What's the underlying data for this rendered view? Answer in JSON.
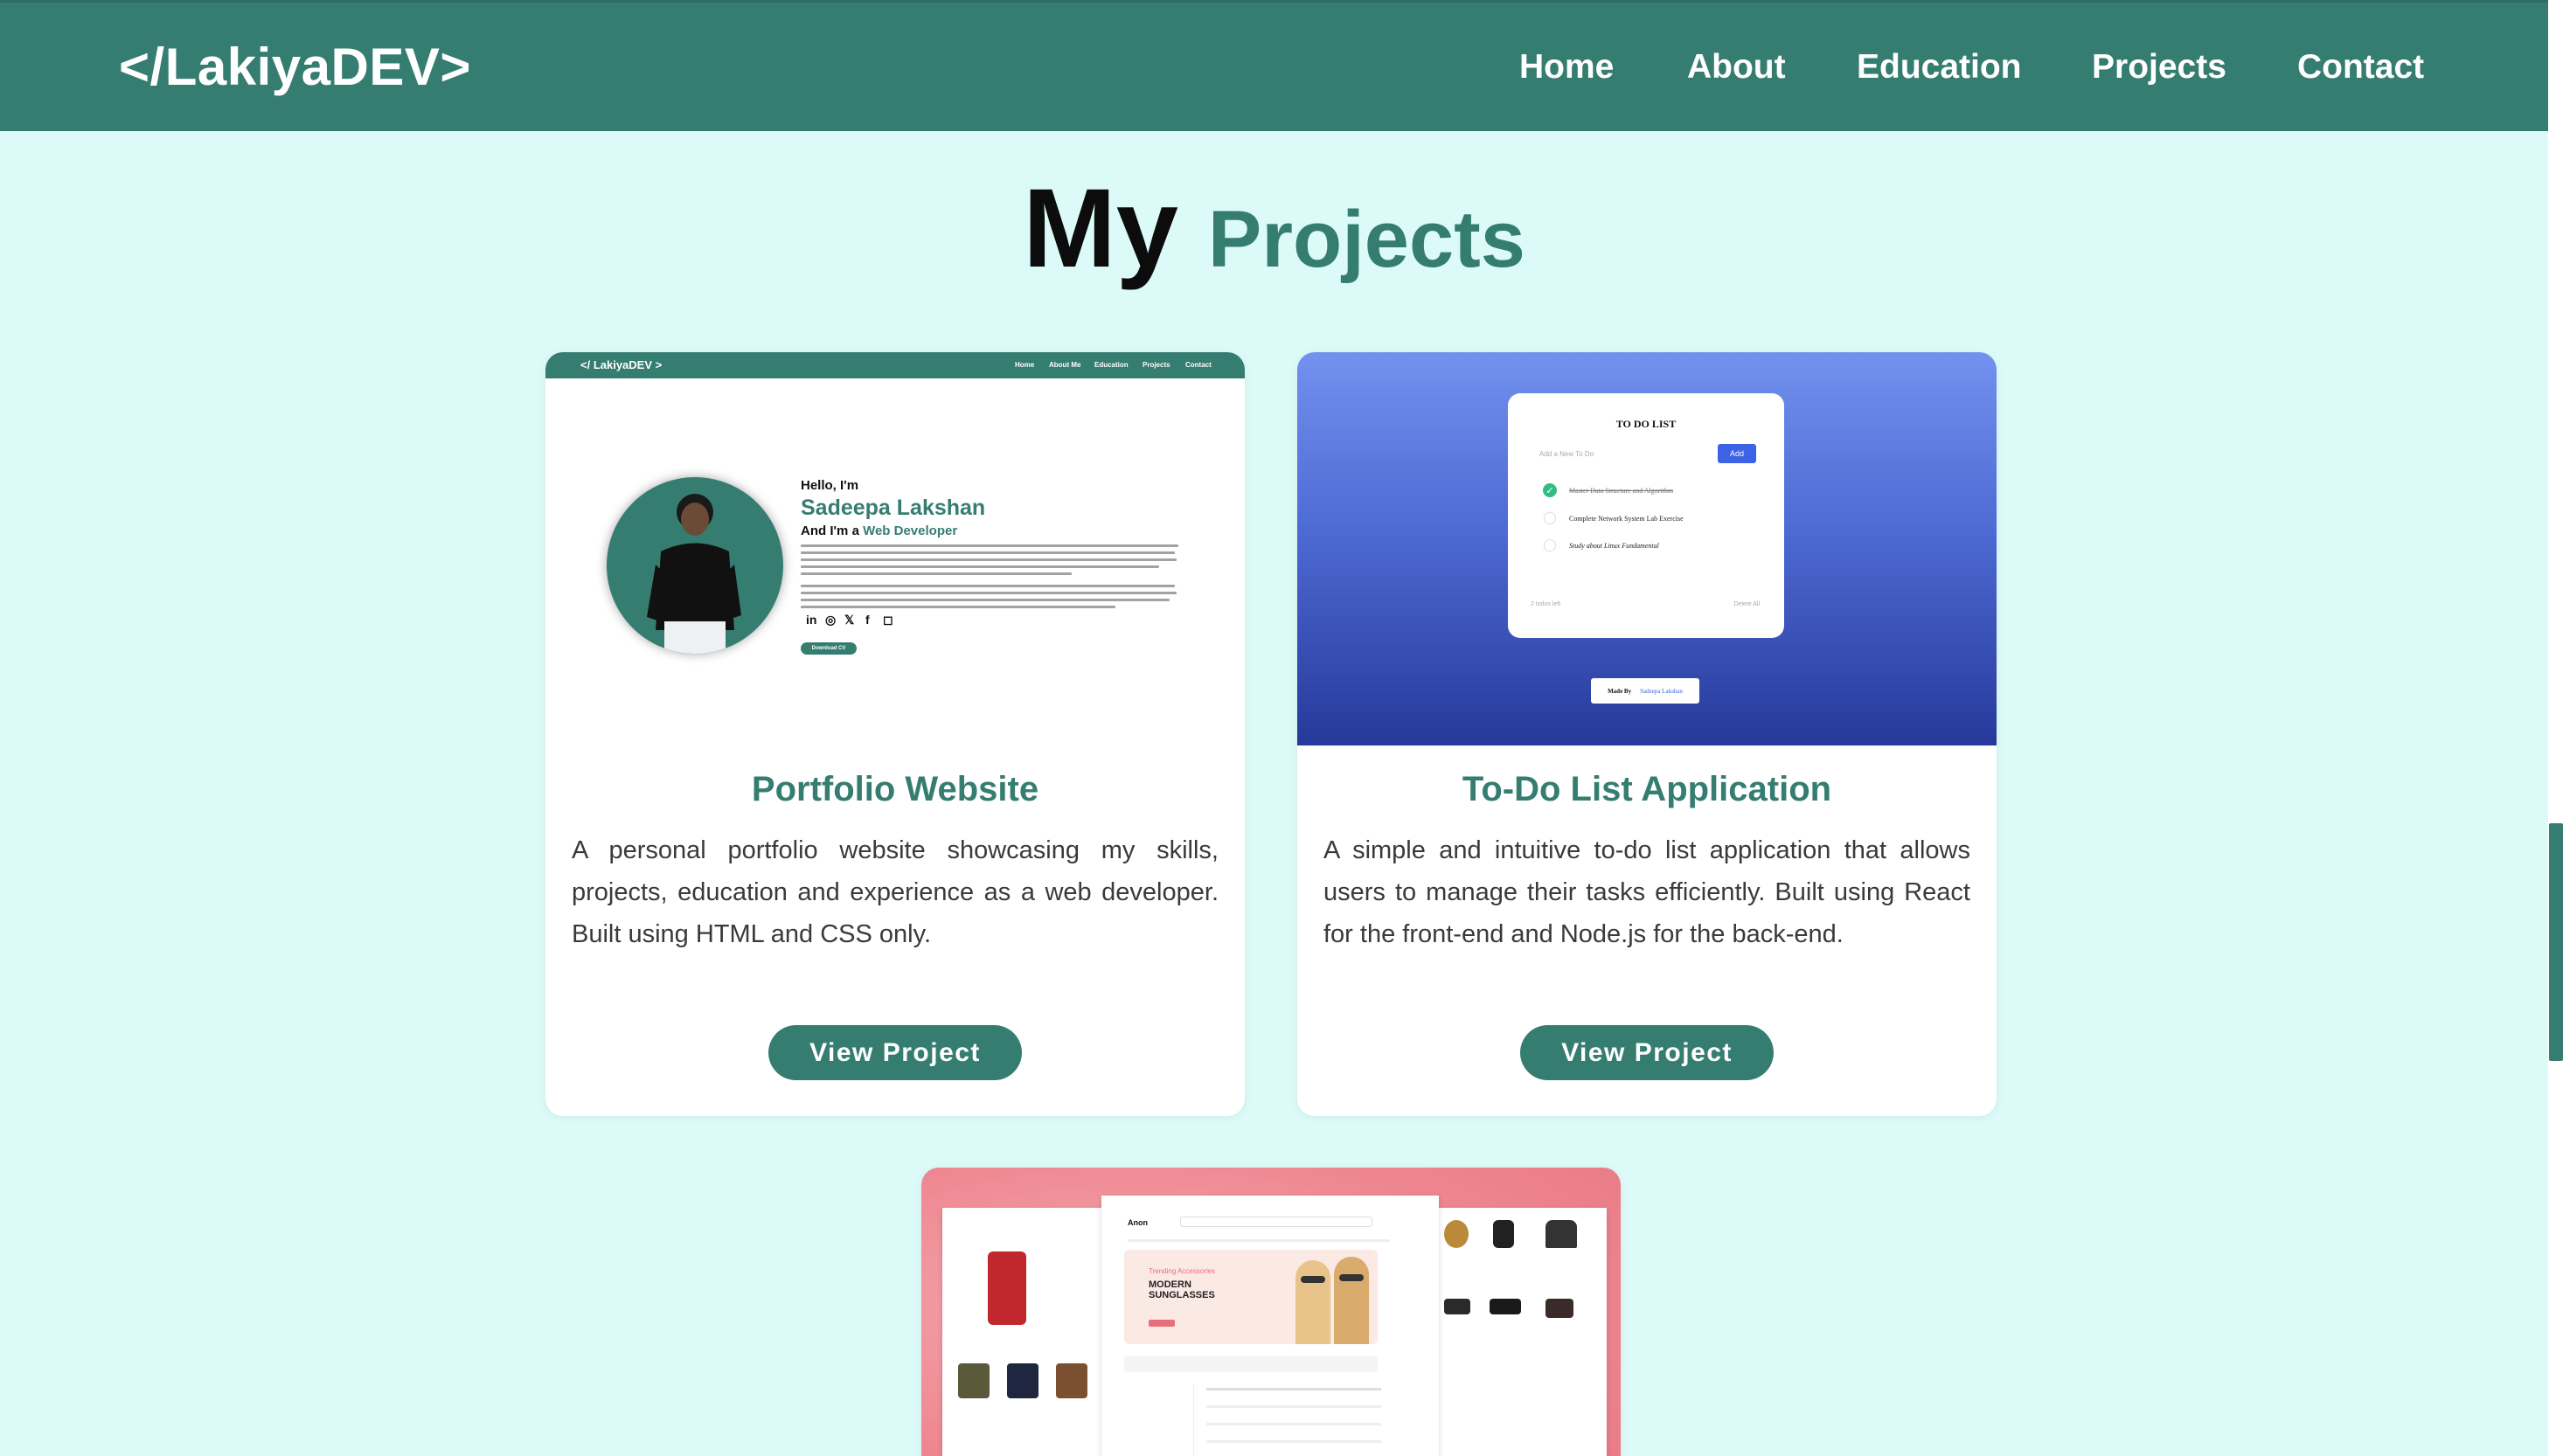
{
  "nav": {
    "logo": "</LakiyaDEV>",
    "links": [
      "Home",
      "About",
      "Education",
      "Projects",
      "Contact"
    ]
  },
  "heading": {
    "word1": "My",
    "word2": "Projects"
  },
  "projects": [
    {
      "title": "Portfolio Website",
      "description": "A personal portfolio website showcasing my skills, projects, education and experience as a web developer. Built using HTML and CSS only.",
      "button": "View Project",
      "thumbnail": {
        "logo": "</ LakiyaDEV >",
        "nav": [
          "Home",
          "About Me",
          "Education",
          "Projects",
          "Contact"
        ],
        "hello": "Hello, I'm",
        "name": "Sadeepa Lakshan",
        "role_prefix": "And I'm a ",
        "role": "Web Developer",
        "cv": "Download CV",
        "social": [
          "in",
          "◎",
          "𝕏",
          "f",
          "◻"
        ]
      }
    },
    {
      "title": "To-Do List Application",
      "description": "A simple and intuitive to-do list application that allows users to manage their tasks efficiently. Built using React for the front-end and Node.js for the back-end.",
      "button": "View Project",
      "thumbnail": {
        "title": "TO DO LIST",
        "placeholder": "Add a New To Do",
        "add": "Add",
        "items": [
          "Master Data Structure and Algorithm",
          "Complete Network System Lab Exercise",
          "Study about Linux Fundamental"
        ],
        "footer_left": "2 todos left",
        "footer_right": "Delete All",
        "made_by": "Made By",
        "author": "Sadeepa Lakshan"
      }
    },
    {
      "title": "",
      "thumbnail": {
        "brand": "Anon",
        "banner_tag": "Trending Accessories",
        "banner_title": "MODERN SUNGLASSES"
      }
    }
  ],
  "colors": {
    "primary": "#367d71",
    "background": "#dcfaf8",
    "nav": "#367d71"
  }
}
